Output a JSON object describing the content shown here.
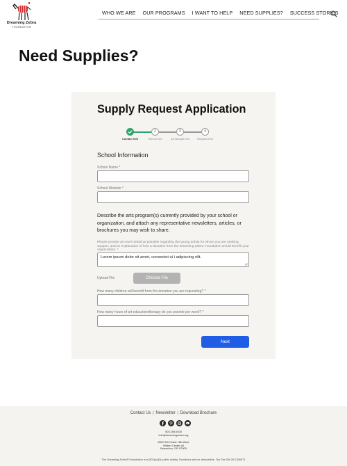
{
  "header": {
    "logo": {
      "name": "Dreaming Zebra",
      "subtitle": "FOUNDATION",
      "small_text": "THE"
    },
    "nav": [
      "WHO WE ARE",
      "OUR PROGRAMS",
      "I WANT TO HELP",
      "NEED SUPPLIES?",
      "SUCCESS STORIES"
    ],
    "search_icon": "search-icon"
  },
  "page_title": "Need Supplies?",
  "form": {
    "title": "Supply Request Application",
    "steps": [
      {
        "label": "Contact Info",
        "number": "1",
        "status": "complete"
      },
      {
        "label": "School Info",
        "number": "2",
        "status": "pending"
      },
      {
        "label": "Art Budget Info",
        "number": "3",
        "status": "pending"
      },
      {
        "label": "Request Info",
        "number": "4",
        "status": "pending"
      }
    ],
    "section_heading": "School Information",
    "school_name": {
      "label": "School Name *",
      "value": ""
    },
    "school_website": {
      "label": "School Website *",
      "value": ""
    },
    "description": "Describe the arts program(s) currently provided by your school or organization, and attach any representative newsletters, articles, or brochures you may wish to share.",
    "details": {
      "help": "Please provide as much detail as possible regarding the young artists for whom you are seeking support, and an explanation of how a donation from the Dreaming Zebra Foundation would benefit your organization. *",
      "value": "Lorem ipsum dolor sit amet, consectet ui i adipiscing elit."
    },
    "upload": {
      "label": "Upload File",
      "button": "Choose File"
    },
    "children": {
      "label": "How many children will benefit from the donation you are requesting? *",
      "value": ""
    },
    "hours": {
      "label": "How many hours of art education/therapy do you provide per week? *",
      "value": ""
    },
    "next_button": "Next"
  },
  "footer": {
    "links": [
      "Contact Us",
      "Newsletter",
      "Download Brochure"
    ],
    "link_separator": "|",
    "socials": [
      "facebook-icon",
      "pinterest-icon",
      "instagram-icon",
      "youtube-icon"
    ],
    "phone": "503.206.6400",
    "email": "info@dreamingzebra.org",
    "address_line1": "2850 SW Cedar Hills Blvd.",
    "address_line2": "Walker Center #4",
    "address_line3": "Beaverton, OR 97005",
    "legal": "The Dreaming Zebra® Foundation is a (501)(c)(3) public charity. Donations are tax deductable. Our Tax ID# 26-2326071"
  },
  "colors": {
    "primary_button": "#1f5de6",
    "step_complete": "#2ea46b",
    "card_background": "#f5f4f1",
    "footer_background": "#f4f3f0",
    "disabled_button": "#b3b3b3"
  }
}
